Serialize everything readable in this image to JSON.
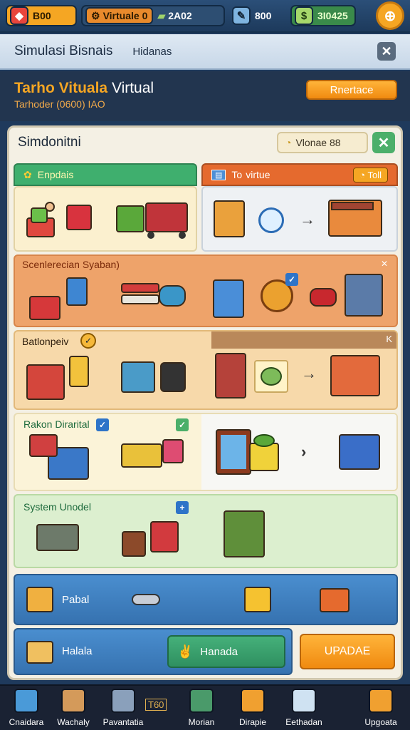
{
  "topbar": {
    "res1_value": "B00",
    "res2_label": "Virtuale",
    "res2_value": "0",
    "res3_value": "2A02",
    "res4_value": "800",
    "res5_value": "3I0425"
  },
  "nav": {
    "title": "Simulasi Bisnais",
    "subtitle": "Hidanas"
  },
  "band": {
    "title_orange": "Tarho Vituala",
    "title_white": "Virtual",
    "subtitle": "Tarhoder (0600) IAO",
    "button": "Rnertace"
  },
  "panel": {
    "heading": "Simdonitni",
    "pill_text": "Vlonae 88",
    "sections": {
      "s1_tab_left": "Enpdais",
      "s1_tab_right": "To  virtue",
      "s1_tab_right_badge": "Toll",
      "s2_label": "Scenlerecian",
      "s2_label2": "Syaban)",
      "s3_label": "Batlonpeiv",
      "s4_label": "Rakon Dirarital",
      "s5_label": "System Unodel"
    },
    "row1_label": "Pabal",
    "row2_label": "Halala",
    "row2_button": "Hanada",
    "upgrade_button": "UPADAE"
  },
  "tabbar": {
    "items": [
      "Cnaidara",
      "Wachaly",
      "Pavantatia",
      "Morian",
      "Dirapie",
      "Eethadan",
      "Upgoata"
    ],
    "extra": "T60"
  },
  "colors": {
    "accent_orange": "#f5a623",
    "green": "#4caf6a",
    "blue": "#3f86c6"
  }
}
